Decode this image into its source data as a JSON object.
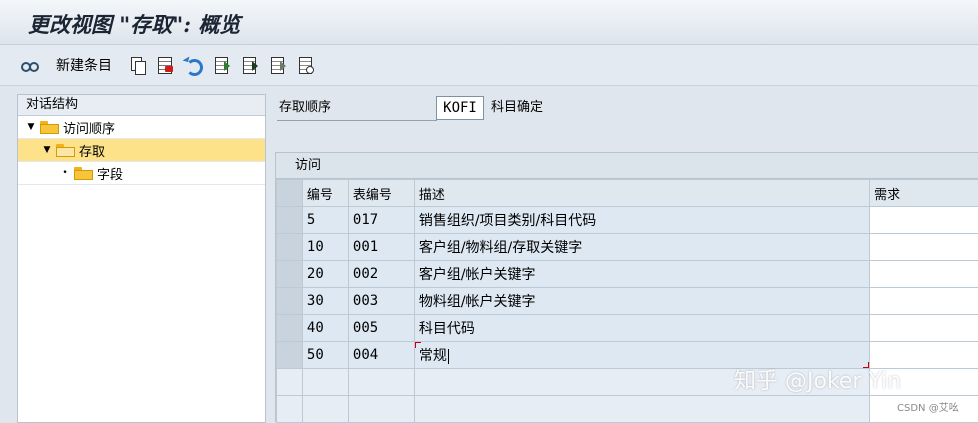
{
  "window": {
    "title": "更改视图 \"存取\": 概览"
  },
  "toolbar": {
    "new_entries_label": "新建条目",
    "icons": [
      "display-change-icon",
      "copy-icon",
      "delete-icon",
      "undo-icon",
      "select-all-icon",
      "select-block-icon",
      "deselect-all-icon",
      "print-icon"
    ]
  },
  "tree": {
    "header": "对话结构",
    "items": [
      {
        "label": "访问顺序",
        "level": 0,
        "expanded": true,
        "selected": false
      },
      {
        "label": "存取",
        "level": 1,
        "expanded": true,
        "selected": true
      },
      {
        "label": "字段",
        "level": 2,
        "expanded": false,
        "selected": false
      }
    ]
  },
  "access_sequence": {
    "label": "存取顺序",
    "value": "KOFI",
    "description": "科目确定"
  },
  "access_table": {
    "title": "访问",
    "columns": [
      "编号",
      "表编号",
      "描述",
      "需求"
    ],
    "rows": [
      {
        "no": "5",
        "table": "017",
        "desc": "销售组织/项目类别/科目代码"
      },
      {
        "no": "10",
        "table": "001",
        "desc": "客户组/物料组/存取关键字"
      },
      {
        "no": "20",
        "table": "002",
        "desc": "客户组/帐户关键字"
      },
      {
        "no": "30",
        "table": "003",
        "desc": "物料组/帐户关键字"
      },
      {
        "no": "40",
        "table": "005",
        "desc": "科目代码"
      },
      {
        "no": "50",
        "table": "004",
        "desc": "常规"
      }
    ]
  },
  "watermark": {
    "text": "知乎 @Joker Yin",
    "small": "CSDN @艾吆"
  },
  "colors": {
    "selected_tree_row": "#fde28a",
    "grid_cell": "#dde8f2",
    "cursor_corners": "#cc0000"
  }
}
